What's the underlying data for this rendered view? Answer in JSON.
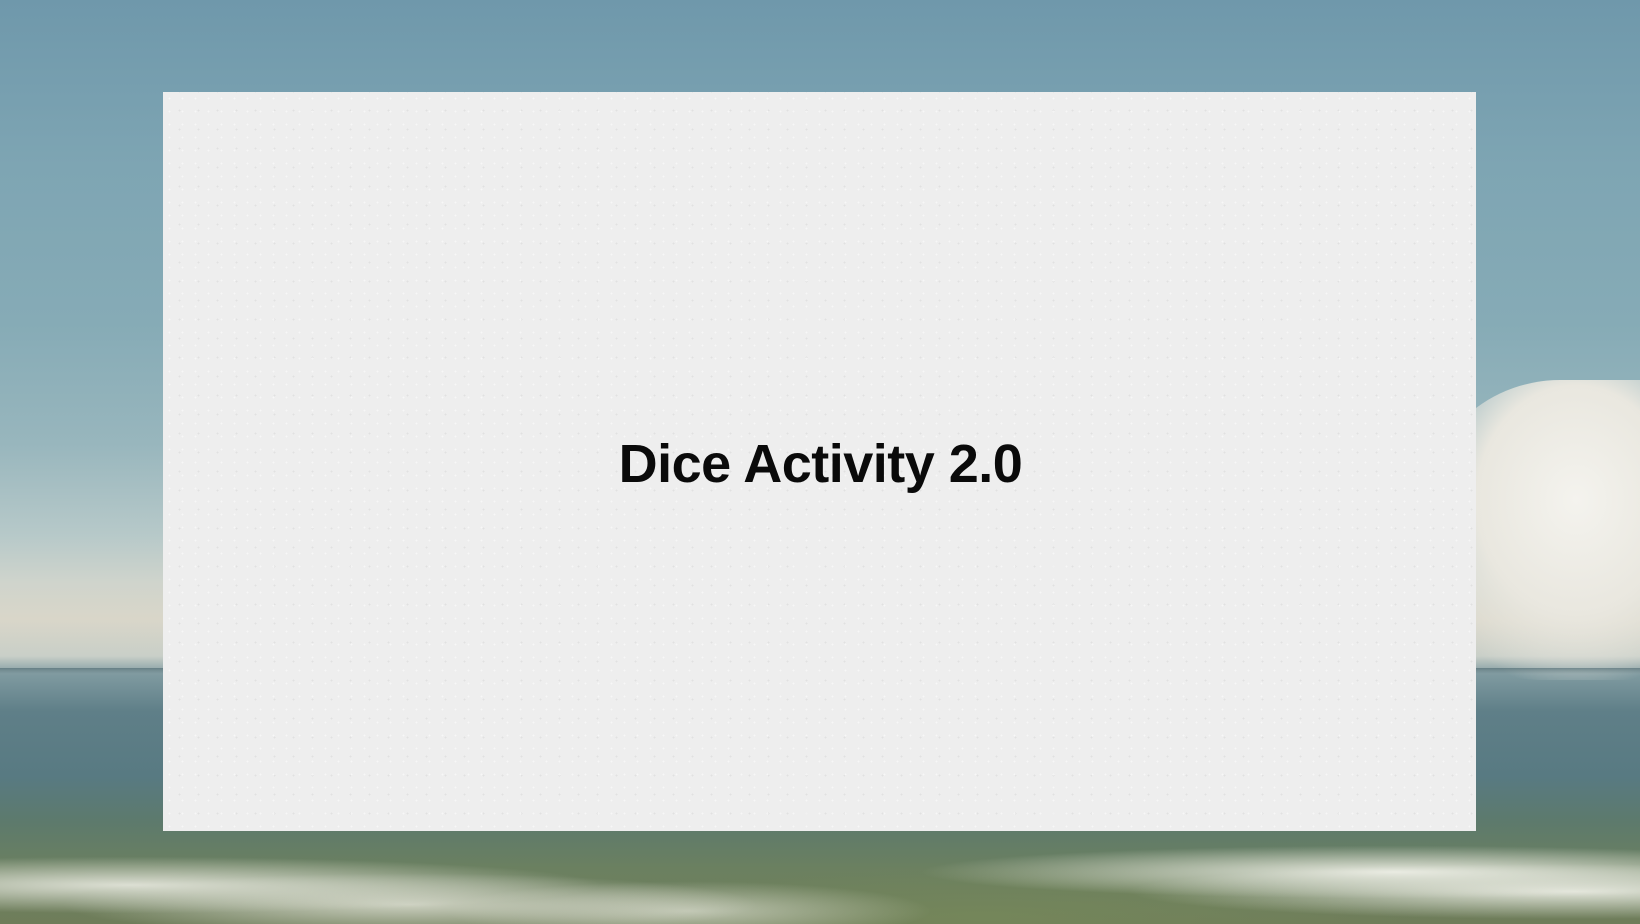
{
  "slide": {
    "title": "Dice Activity 2.0"
  },
  "colors": {
    "card_background": "#eeeeee",
    "title_text": "#0a0a0a"
  }
}
